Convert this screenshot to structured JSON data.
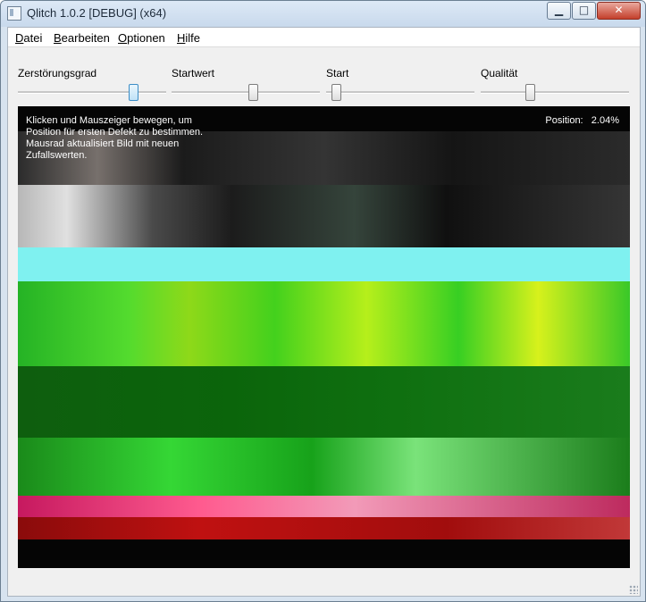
{
  "window": {
    "title": "Qlitch 1.0.2 [DEBUG] (x64)"
  },
  "menu": [
    {
      "pre": "",
      "u": "D",
      "post": "atei"
    },
    {
      "pre": "",
      "u": "B",
      "post": "earbeiten"
    },
    {
      "pre": "",
      "u": "O",
      "post": "ptionen"
    },
    {
      "pre": "",
      "u": "H",
      "post": "ilfe"
    }
  ],
  "sliders": [
    {
      "label": "Zerstörungsgrad",
      "value": 0.79
    },
    {
      "label": "Startwert",
      "value": 0.55
    },
    {
      "label": "Start",
      "value": 0.04
    },
    {
      "label": "Qualität",
      "value": 0.32
    }
  ],
  "image": {
    "hint": "Klicken und Mauszeiger bewegen, um Position für ersten Defekt zu bestimmen. Mausrad aktualisiert Bild mit neuen Zufallswerten.",
    "position_label": "Position:",
    "position_value": "2.04%"
  },
  "colors": {
    "glitch_cyan": "#7ff1f0",
    "glitch_green": "#1fd51f",
    "glitch_dark_green": "#0b650b",
    "glitch_red": "#bf1111",
    "glitch_pink": "#f15a8d"
  },
  "icons": {
    "app": "qlitch-app-icon",
    "minimize": "minimize-icon",
    "maximize": "maximize-icon",
    "close": "close-icon"
  }
}
